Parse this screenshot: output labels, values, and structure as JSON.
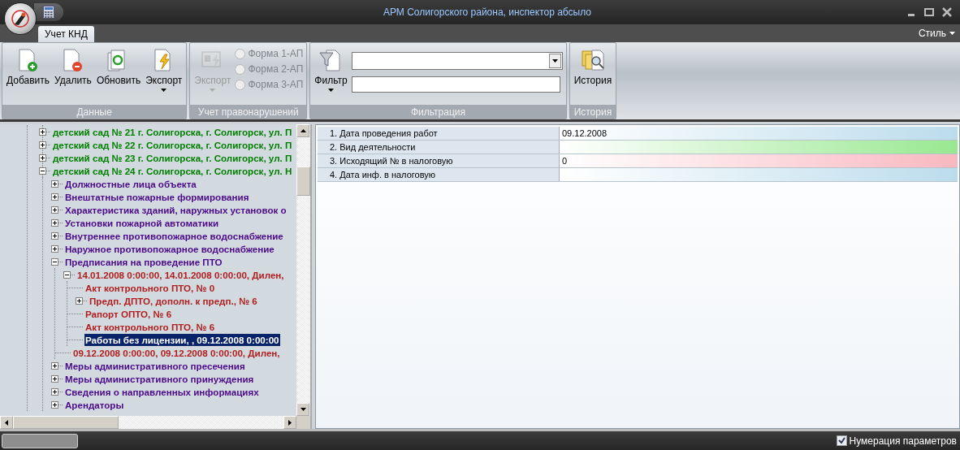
{
  "window": {
    "title": "АРМ Солигорского района, инспектор абсыло"
  },
  "ribbon": {
    "tabs": [
      {
        "label": "Учет КНД",
        "selected": true
      }
    ],
    "style_menu": "Стиль",
    "groups": [
      {
        "title": "Данные",
        "buttons": [
          {
            "label": "Добавить",
            "kind": "add",
            "disabled": false,
            "dropdown": false
          },
          {
            "label": "Удалить",
            "kind": "delete",
            "disabled": false,
            "dropdown": false
          },
          {
            "label": "Обновить",
            "kind": "refresh",
            "disabled": false,
            "dropdown": false
          },
          {
            "label": "Экспорт",
            "kind": "export",
            "disabled": false,
            "dropdown": true
          }
        ]
      },
      {
        "title": "Учет правонарушений",
        "buttons": [
          {
            "label": "Экспорт",
            "kind": "export-card",
            "disabled": true,
            "dropdown": true
          }
        ],
        "radios": [
          {
            "label": "Форма 1-АП",
            "selected": false,
            "disabled": true
          },
          {
            "label": "Форма 2-АП",
            "selected": false,
            "disabled": true
          },
          {
            "label": "Форма 3-АП",
            "selected": false,
            "disabled": true
          }
        ]
      },
      {
        "title": "Фильтрация",
        "buttons": [
          {
            "label": "Фильтр",
            "kind": "filter",
            "disabled": false,
            "dropdown": true
          }
        ],
        "fields": [
          {
            "kind": "combo"
          },
          {
            "kind": "text"
          }
        ]
      },
      {
        "title": "История",
        "buttons": [
          {
            "label": "История",
            "kind": "history",
            "disabled": false,
            "dropdown": false
          }
        ]
      }
    ]
  },
  "tree": {
    "items": [
      {
        "label": "детский сад № 21 г. Солигорска, г. Солигорск, ул. П",
        "kind": "object",
        "expanded": false,
        "selected": false
      },
      {
        "label": "детский сад № 22 г. Солигорска, г. Солигорск, ул. П",
        "kind": "object",
        "expanded": false,
        "selected": false
      },
      {
        "label": "детский сад № 23 г. Солигорска, г. Солигорск, ул. П",
        "kind": "object",
        "expanded": false,
        "selected": false
      },
      {
        "label": "детский сад № 24 г. Солигорска, г. Солигорск, ул. Н",
        "kind": "object",
        "expanded": true,
        "selected": false,
        "children": [
          {
            "label": "Должностные лица объекта",
            "kind": "section",
            "expanded": false,
            "selected": false
          },
          {
            "label": "Внештатные пожарные формирования",
            "kind": "section",
            "expanded": false,
            "selected": false
          },
          {
            "label": "Характеристика зданий, наружных установок о",
            "kind": "section",
            "expanded": false,
            "selected": false
          },
          {
            "label": "Установки пожарной автоматики",
            "kind": "section",
            "expanded": false,
            "selected": false
          },
          {
            "label": "Внутреннее противопожарное водоснабжение",
            "kind": "section",
            "expanded": false,
            "selected": false
          },
          {
            "label": "Наружное противопожарное водоснабжение",
            "kind": "section",
            "expanded": false,
            "selected": false
          },
          {
            "label": "Предписания на проведение ПТО",
            "kind": "section",
            "expanded": true,
            "selected": false,
            "children": [
              {
                "label": "14.01.2008 0:00:00, 14.01.2008 0:00:00, Дилен,",
                "kind": "document",
                "expanded": true,
                "selected": false,
                "children": [
                  {
                    "label": "Акт контрольного ПТО, № 0",
                    "kind": "document",
                    "selected": false
                  },
                  {
                    "label": "Предп. ДПТО, дополн. к предп., № 6",
                    "kind": "document",
                    "expanded": false,
                    "selected": false
                  },
                  {
                    "label": "Рапорт ОПТО, № 6",
                    "kind": "document",
                    "selected": false
                  },
                  {
                    "label": "Акт контрольного ПТО, № 6",
                    "kind": "document",
                    "selected": false
                  },
                  {
                    "label": "Работы без лицензии, , 09.12.2008 0:00:00",
                    "kind": "document",
                    "selected": true
                  }
                ]
              },
              {
                "label": "09.12.2008 0:00:00, 09.12.2008 0:00:00, Дилен,",
                "kind": "document",
                "selected": false
              }
            ]
          },
          {
            "label": "Меры административного пресечения",
            "kind": "section",
            "expanded": false,
            "selected": false
          },
          {
            "label": "Меры административного принуждения",
            "kind": "section",
            "expanded": false,
            "selected": false
          },
          {
            "label": "Сведения о направленных информациях",
            "kind": "section",
            "expanded": false,
            "selected": false
          },
          {
            "label": "Арендаторы",
            "kind": "section",
            "expanded": false,
            "selected": false
          }
        ]
      }
    ]
  },
  "properties": [
    {
      "name": "1. Дата проведения работ",
      "value": "09.12.2008",
      "color": "#bcdcec"
    },
    {
      "name": "2. Вид деятельности",
      "color": "#98e890"
    },
    {
      "name": "3. Исходящий № в налоговую",
      "value": "0",
      "color": "#f8b8c0"
    },
    {
      "name": "4. Дата инф. в налоговую",
      "color": "#bcdcec"
    }
  ],
  "status_bar": {
    "numbering": {
      "label": "Нумерация параметров",
      "checked": true
    }
  }
}
